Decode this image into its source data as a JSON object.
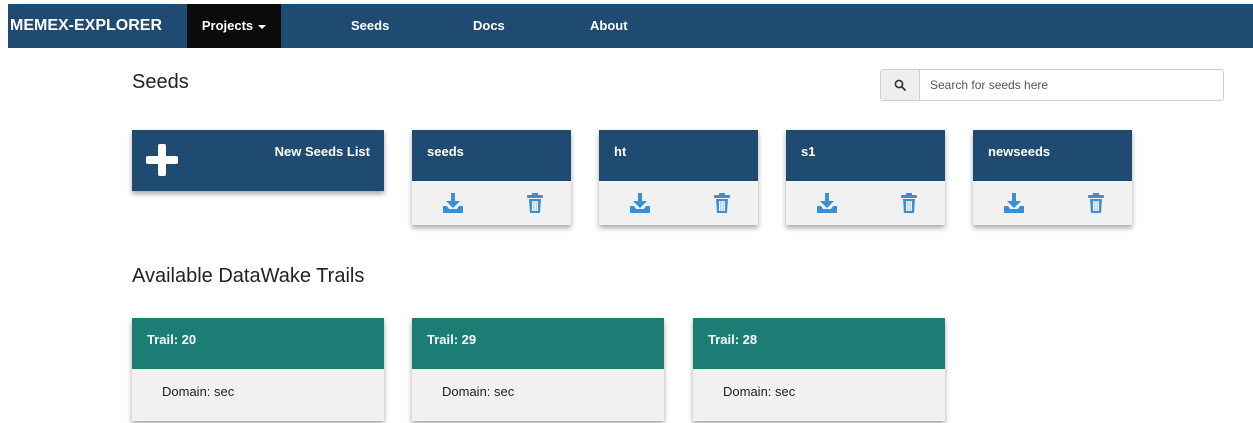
{
  "navbar": {
    "brand": "MEMEX-EXPLORER",
    "items": [
      "Projects",
      "Seeds",
      "Docs",
      "About"
    ]
  },
  "seeds_section": {
    "title": "Seeds",
    "search_placeholder": "Search for seeds here",
    "new_card_label": "New Seeds List",
    "seed_lists": [
      "seeds",
      "ht",
      "s1",
      "newseeds"
    ]
  },
  "trails_section": {
    "title": "Available DataWake Trails",
    "trails": [
      {
        "title": "Trail: 20",
        "domain": "Domain: sec"
      },
      {
        "title": "Trail: 29",
        "domain": "Domain: sec"
      },
      {
        "title": "Trail: 28",
        "domain": "Domain: sec"
      }
    ]
  },
  "colors": {
    "navbar": "#1f4a72",
    "seed_card_header": "#1f4a72",
    "trail_card_header": "#1b7d74",
    "icon_blue": "#3a8fd6"
  },
  "icons": {
    "search": "search-icon",
    "download": "download-icon",
    "trash": "trash-icon",
    "plus": "plus-icon"
  }
}
